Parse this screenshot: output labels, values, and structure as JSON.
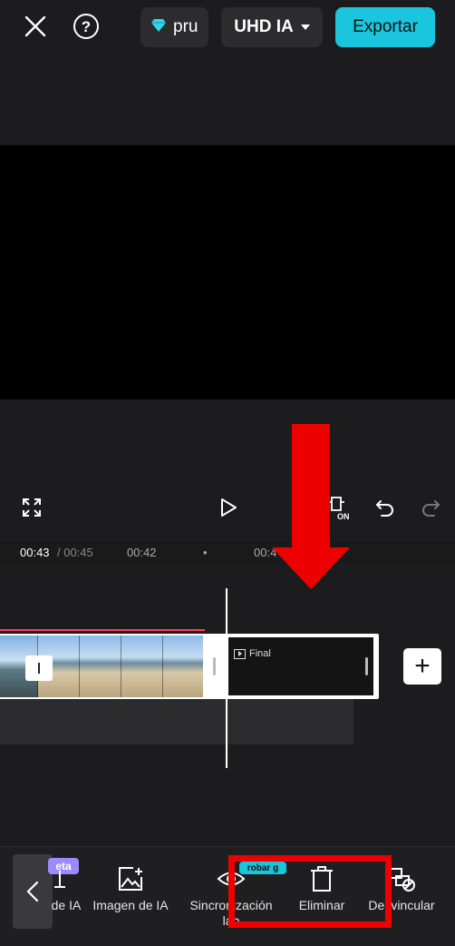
{
  "header": {
    "close_icon": "close-icon",
    "help_icon": "help-icon",
    "pro_icon": "diamond-icon",
    "pro_label": "pru",
    "resolution_label": "UHD IA",
    "export_label": "Exportar",
    "accent_color": "#19c6dd"
  },
  "player": {
    "fullscreen_icon": "fullscreen-icon",
    "play_icon": "play-icon",
    "keyframe_badge": "ON",
    "undo_icon": "undo-icon",
    "redo_icon": "redo-icon"
  },
  "timeline": {
    "current_time": "00:43",
    "total_time": "/ 00:45",
    "marker_1": "00:42",
    "marker_dot": "•",
    "marker_2": "00:4",
    "end_clip_label": "Final",
    "add_label": "+"
  },
  "toolbar": {
    "beta_badge": "eta",
    "try_badge": "robar g",
    "items": [
      {
        "label": "de IA",
        "icon": "ai-icon"
      },
      {
        "label": "Imagen de IA",
        "icon": "ai-image-icon"
      },
      {
        "label": "Sincronización\nlab",
        "icon": "lip-sync-icon"
      },
      {
        "label": "Eliminar",
        "icon": "trash-icon"
      },
      {
        "label": "Desvincular",
        "icon": "unlink-icon"
      }
    ]
  },
  "annotation_color": "#ee0000"
}
